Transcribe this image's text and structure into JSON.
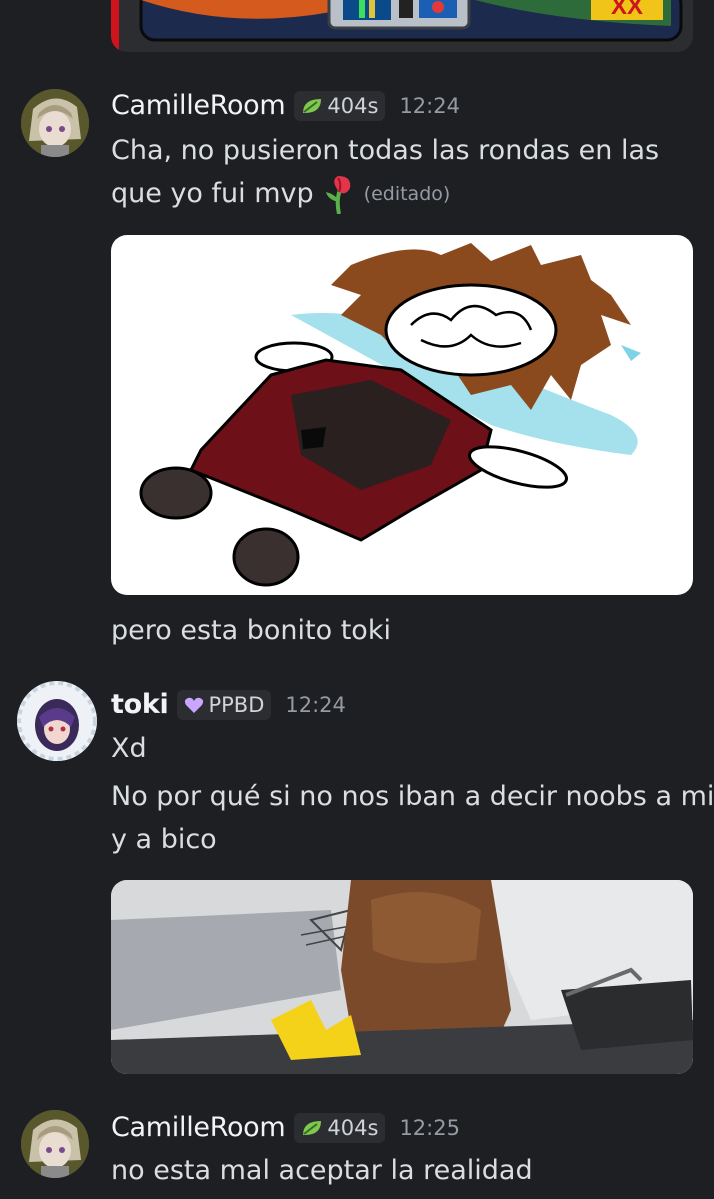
{
  "top_embed": {
    "label": "XX"
  },
  "messages": [
    {
      "author": "CamilleRoom",
      "badge": "404s",
      "time": "12:24",
      "lines": [
        "Cha, no pusieron todas las rondas en las",
        "que yo fui mvp"
      ],
      "edited": "(editado)",
      "followup": "pero esta bonito toki"
    },
    {
      "author": "toki",
      "badge": "PPBD",
      "time": "12:24",
      "lines": [
        "Xd",
        "No por qué si no nos iban a decir noobs a mi",
        "y a bico"
      ]
    },
    {
      "author": "CamilleRoom",
      "badge": "404s",
      "time": "12:25",
      "lines": [
        "no esta mal aceptar la realidad"
      ]
    }
  ],
  "colors": {
    "background": "#1e1f22",
    "badge_bg": "#2b2d31",
    "leaf_badge": "#7ec850",
    "heart_badge": "#c9a6ff",
    "timestamp": "#949ba4"
  }
}
